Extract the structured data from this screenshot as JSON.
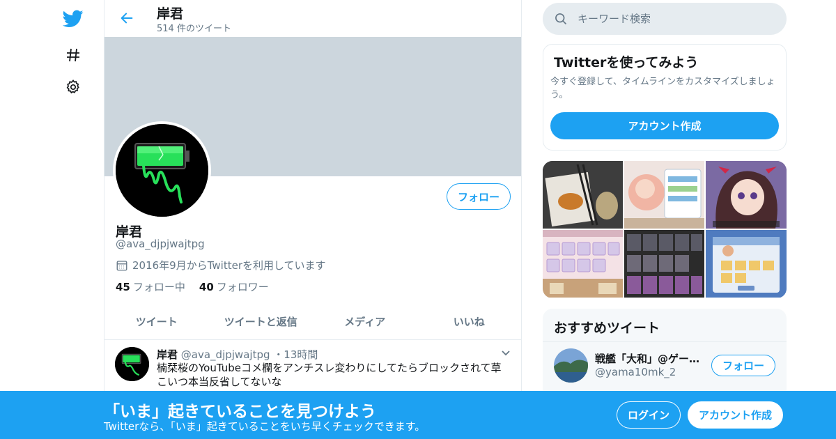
{
  "nav": {
    "icons": [
      "twitter-bird-icon",
      "hashtag-icon",
      "settings-gear-icon"
    ]
  },
  "header": {
    "title": "岸君",
    "tweet_count": "514 件のツイート"
  },
  "profile": {
    "follow_label": "フォロー",
    "name": "岸君",
    "handle": "@ava_djpjwajtpg",
    "joined": "2016年9月からTwitterを利用しています",
    "following_count": "45",
    "following_label": "フォロー中",
    "followers_count": "40",
    "followers_label": "フォロワー"
  },
  "tabs": [
    {
      "label": "ツイート"
    },
    {
      "label": "ツイートと返信"
    },
    {
      "label": "メディア"
    },
    {
      "label": "いいね"
    }
  ],
  "tweet": {
    "name": "岸君",
    "handle": "@ava_djpjwajtpg",
    "time": "・13時間",
    "line1": "楠栞桜のYouTubeコメ欄をアンチスレ変わりにしてたらブロックされて草",
    "line2": "こいつ本当反省してないな"
  },
  "search": {
    "placeholder": "キーワード検索"
  },
  "signup_card": {
    "title": "Twitterを使ってみよう",
    "description": "今すぐ登録して、タイムラインをカスタマイズしましょう。",
    "button": "アカウント作成"
  },
  "media": {
    "count": 6
  },
  "recommended": {
    "title": "おすすめツイート",
    "name": "戦艦「大和」@ゲー…",
    "handle": "@yama10mk_2",
    "follow_label": "フォロー"
  },
  "bottom_bar": {
    "title": "「いま」起きていることを見つけよう",
    "subtitle": "Twitterなら、「いま」起きていることをいち早くチェックできます。",
    "login": "ログイン",
    "signup": "アカウント作成"
  },
  "colors": {
    "accent": "#1da1f2",
    "banner": "#ccd6dd",
    "secondary_text": "#657786"
  }
}
